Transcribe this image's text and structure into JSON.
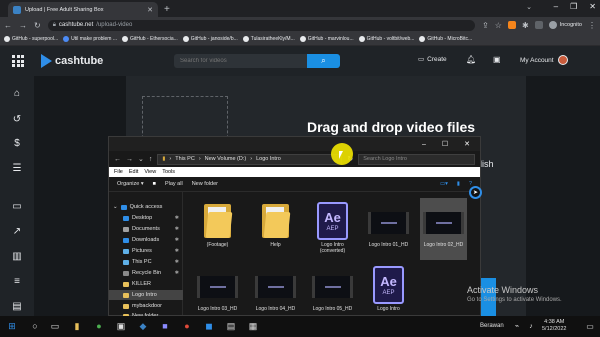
{
  "browser": {
    "tab_title": "Upload | Free Adult Sharing Box",
    "url_domain": "cashtube.net",
    "url_path": "/upload-video",
    "incognito_label": "Incognito",
    "bookmarks": [
      "GitHub - superpool...",
      "Util make problem ...",
      "GitHub - Ethersocia...",
      "GitHub - janoside/b...",
      "TulasiratheeKly/M...",
      "GitHub - marvinlou...",
      "GitHub - voltbit/web...",
      "GitHub - MicroBitc..."
    ]
  },
  "site": {
    "logo_text": "cashtube",
    "search_placeholder": "Search for videos",
    "create_label": "Create",
    "account_label": "My Account"
  },
  "upload": {
    "drag_title": "Drag and drop video files",
    "publish_fragment": "lish"
  },
  "explorer": {
    "path": [
      "This PC",
      "New Volume (D:)",
      "Logo Intro"
    ],
    "search_placeholder": "Search Logo Intro",
    "menu": [
      "File",
      "Edit",
      "View",
      "Tools"
    ],
    "toolbar": [
      "Organize",
      "Play all",
      "New folder"
    ],
    "nav": [
      "Quick access",
      "Desktop",
      "Documents",
      "Downloads",
      "Pictures",
      "This PC",
      "Recycle Bin",
      "KILLER",
      "Logo Intro",
      "mybackdoor",
      "New folder",
      "OneDrive"
    ],
    "files": [
      {
        "label": "(Footage)",
        "kind": "folder"
      },
      {
        "label": "Help",
        "kind": "folder"
      },
      {
        "label": "Logo Intro (converted)",
        "kind": "ae"
      },
      {
        "label": "Logo Intro 01_HD",
        "kind": "video"
      },
      {
        "label": "Logo Intro 02_HD",
        "kind": "video"
      },
      {
        "label": "Logo Intro 03_HD",
        "kind": "video"
      },
      {
        "label": "Logo Intro 04_HD",
        "kind": "video"
      },
      {
        "label": "Logo Intro 05_HD",
        "kind": "video"
      },
      {
        "label": "Logo Intro",
        "kind": "ae"
      }
    ],
    "ae_text": "Ae",
    "ae_sub": "AEP"
  },
  "activate": {
    "title": "Activate Windows",
    "subtitle": "Go to Settings to activate Windows."
  },
  "taskbar": {
    "language": "Berawan",
    "time": "4:38 AM",
    "date": "5/12/2022"
  }
}
